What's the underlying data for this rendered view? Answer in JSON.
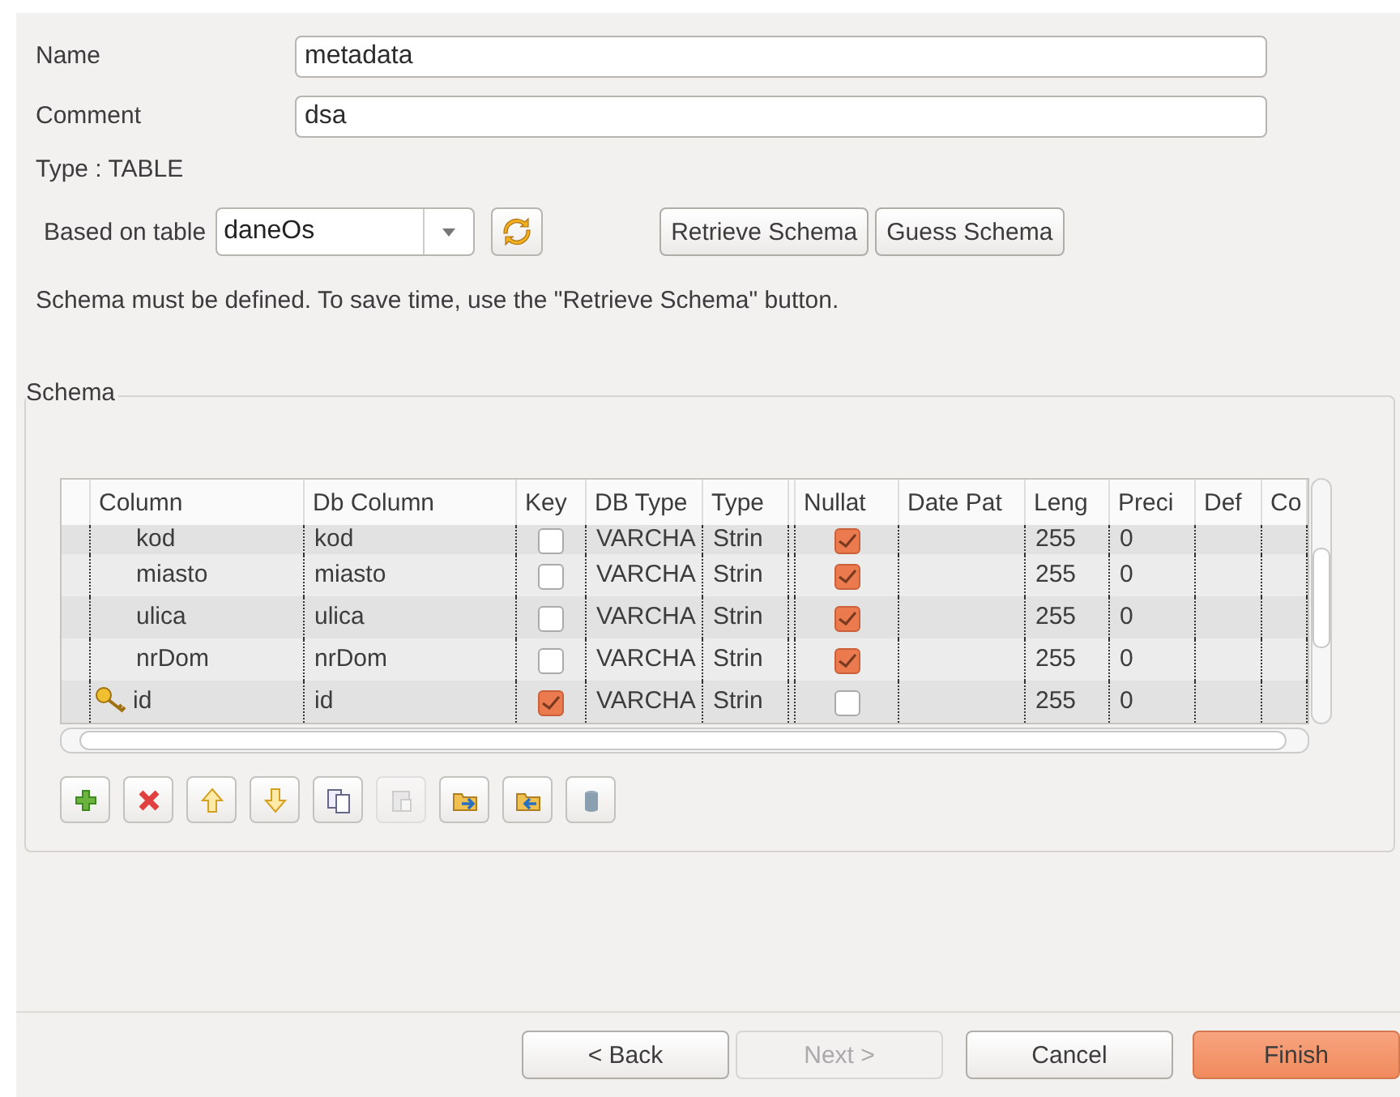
{
  "fields": [
    {
      "label": "Name",
      "value": "metadata"
    },
    {
      "label": "Comment",
      "value": "dsa"
    }
  ],
  "type_label": "Type : TABLE",
  "based_on": {
    "label": "Based on table",
    "value": "daneOs"
  },
  "schema_buttons": [
    "Retrieve Schema",
    "Guess Schema"
  ],
  "message": "Schema must be defined. To save time, use the \"Retrieve Schema\" button.",
  "schema": {
    "title": "Schema",
    "columns": [
      "Column",
      "Db Column",
      "Key",
      "DB Type",
      "Type",
      "Nullat",
      "Date Pat",
      "Leng",
      "Preci",
      "Def",
      "Co"
    ],
    "rows": [
      {
        "column": "kod",
        "db_column": "kod",
        "key": false,
        "db_type": "VARCHA",
        "type": "Strin",
        "nullable": true,
        "length": "255",
        "precision": "0",
        "partial": true
      },
      {
        "column": "miasto",
        "db_column": "miasto",
        "key": false,
        "db_type": "VARCHA",
        "type": "Strin",
        "nullable": true,
        "length": "255",
        "precision": "0",
        "partial": false
      },
      {
        "column": "ulica",
        "db_column": "ulica",
        "key": false,
        "db_type": "VARCHA",
        "type": "Strin",
        "nullable": true,
        "length": "255",
        "precision": "0",
        "partial": false
      },
      {
        "column": "nrDom",
        "db_column": "nrDom",
        "key": false,
        "db_type": "VARCHA",
        "type": "Strin",
        "nullable": true,
        "length": "255",
        "precision": "0",
        "partial": false
      },
      {
        "column": "id",
        "db_column": "id",
        "key": true,
        "db_type": "VARCHA",
        "type": "Strin",
        "nullable": false,
        "length": "255",
        "precision": "0",
        "partial": false
      }
    ],
    "toolbar": [
      {
        "kind": "add",
        "disabled": false
      },
      {
        "kind": "remove",
        "disabled": false
      },
      {
        "kind": "up",
        "disabled": false
      },
      {
        "kind": "down",
        "disabled": false
      },
      {
        "kind": "copy",
        "disabled": false
      },
      {
        "kind": "paste",
        "disabled": true
      },
      {
        "kind": "import",
        "disabled": false
      },
      {
        "kind": "export",
        "disabled": false
      },
      {
        "kind": "database",
        "disabled": false
      }
    ]
  },
  "footer_buttons": [
    {
      "label": "< Back",
      "disabled": false,
      "primary": false
    },
    {
      "label": "Next >",
      "disabled": true,
      "primary": false
    },
    {
      "label": "Cancel",
      "disabled": false,
      "primary": false
    },
    {
      "label": "Finish",
      "disabled": false,
      "primary": true
    }
  ]
}
